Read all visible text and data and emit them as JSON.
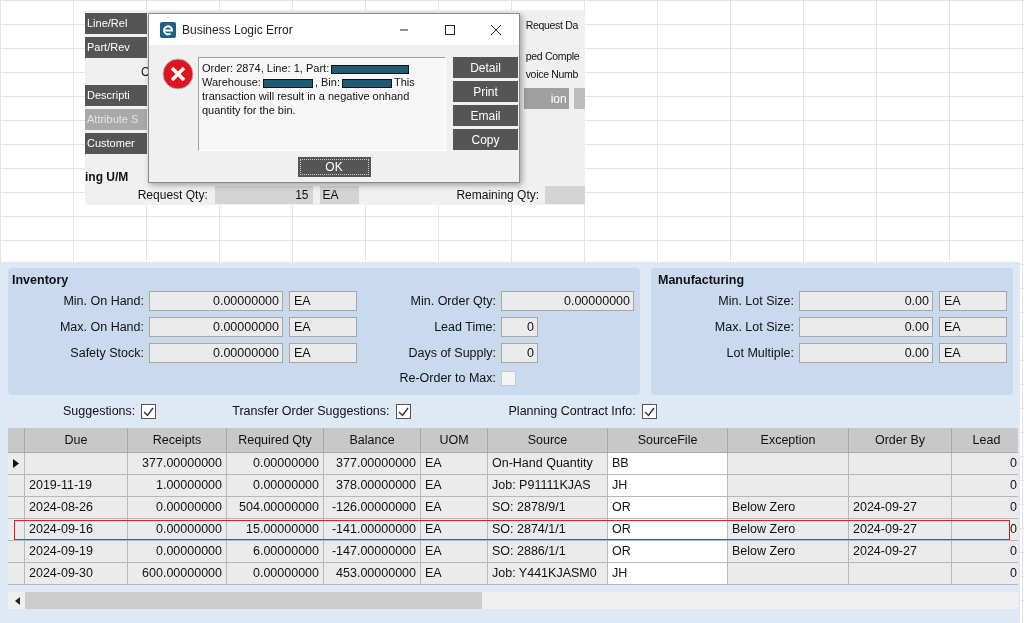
{
  "form_behind": {
    "left_items": [
      {
        "kind": "button",
        "label": "Line/Rel",
        "disabled": false
      },
      {
        "kind": "button",
        "label": "Part/Rev",
        "disabled": false
      },
      {
        "kind": "label",
        "label": "C"
      },
      {
        "kind": "button",
        "label": "Descripti",
        "disabled": false
      },
      {
        "kind": "button",
        "label": "Attribute S",
        "disabled": true
      },
      {
        "kind": "button",
        "label": "Customer",
        "disabled": false
      }
    ],
    "right_labels": [
      "Request Da",
      "ped Comple",
      "voice Numb"
    ],
    "right_button": {
      "label": "ion",
      "disabled": true
    },
    "section_title": "ing U/M",
    "request_qty": {
      "label": "Request Qty:",
      "value": "15",
      "uom": "EA"
    },
    "remaining_qty": {
      "label": "Remaining Qty:"
    }
  },
  "dialog": {
    "title": "Business Logic Error",
    "message": [
      {
        "kind": "text",
        "text": "Order: 2874, Line: 1, Part:"
      },
      {
        "kind": "redacted"
      },
      {
        "kind": "text",
        "text": "Warehouse:"
      },
      {
        "kind": "redacted"
      },
      {
        "kind": "text",
        "text": ", Bin:"
      },
      {
        "kind": "redacted"
      },
      {
        "kind": "text",
        "text": "This"
      },
      {
        "kind": "paragraph",
        "text": "transaction will result in a negative onhand quantity for the bin."
      }
    ],
    "side_buttons": [
      "Detail",
      "Print",
      "Email",
      "Copy"
    ],
    "ok_button": "OK"
  },
  "inventory": {
    "title": "Inventory",
    "fields": [
      {
        "label": "Min. On Hand:",
        "value": "0.00000000",
        "uom": "EA"
      },
      {
        "label": "Max. On Hand:",
        "value": "0.00000000",
        "uom": "EA"
      },
      {
        "label": "Safety Stock:",
        "value": "0.00000000",
        "uom": "EA"
      }
    ],
    "order_fields": [
      {
        "kind": "wide",
        "label": "Min. Order Qty:",
        "value": "0.00000000"
      },
      {
        "kind": "narrow",
        "label": "Lead Time:",
        "value": "0"
      },
      {
        "kind": "narrow",
        "label": "Days of Supply:",
        "value": "0"
      },
      {
        "kind": "checkbox",
        "label": "Re-Order to Max:",
        "checked": false,
        "disabled": true
      }
    ]
  },
  "manufacturing": {
    "title": "Manufacturing",
    "fields": [
      {
        "label": "Min. Lot Size:",
        "value": "0.00",
        "uom": "EA"
      },
      {
        "label": "Max. Lot Size:",
        "value": "0.00",
        "uom": "EA"
      },
      {
        "label": "Lot Multiple:",
        "value": "0.00",
        "uom": "EA"
      }
    ]
  },
  "options": [
    {
      "label": "Suggestions:",
      "checked": true
    },
    {
      "label": "Transfer Order Suggestions:",
      "checked": true
    },
    {
      "label": "Planning Contract Info:",
      "checked": true
    }
  ],
  "grid": {
    "columns": [
      "Due",
      "Receipts",
      "Required Qty",
      "Balance",
      "UOM",
      "Source",
      "SourceFile",
      "Exception",
      "Order By",
      "Lead"
    ],
    "rows": [
      {
        "current": true,
        "highlighted": false,
        "receipts": "377.00000000",
        "required_qty": "0.00000000",
        "balance": "377.00000000",
        "uom": "EA",
        "source": "On-Hand Quantity",
        "source_file": "BB",
        "lead": "0"
      },
      {
        "current": false,
        "highlighted": false,
        "due": "2019-11-19",
        "receipts": "1.00000000",
        "required_qty": "0.00000000",
        "balance": "378.00000000",
        "uom": "EA",
        "source": "Job: P91111KJAS",
        "source_file": "JH",
        "lead": "0"
      },
      {
        "current": false,
        "highlighted": false,
        "due": "2024-08-26",
        "receipts": "0.00000000",
        "required_qty": "504.00000000",
        "balance": "-126.00000000",
        "uom": "EA",
        "source": "SO: 2878/9/1",
        "source_file": "OR",
        "exception": "Below Zero",
        "order_by": "2024-09-27",
        "lead": "0"
      },
      {
        "current": false,
        "highlighted": true,
        "due": "2024-09-16",
        "receipts": "0.00000000",
        "required_qty": "15.00000000",
        "balance": "-141.00000000",
        "uom": "EA",
        "source": "SO: 2874/1/1",
        "source_file": "OR",
        "exception": "Below Zero",
        "order_by": "2024-09-27",
        "lead": "0"
      },
      {
        "current": false,
        "highlighted": false,
        "due": "2024-09-19",
        "receipts": "0.00000000",
        "required_qty": "6.00000000",
        "balance": "-147.00000000",
        "uom": "EA",
        "source": "SO: 2886/1/1",
        "source_file": "OR",
        "exception": "Below Zero",
        "order_by": "2024-09-27",
        "lead": "0"
      },
      {
        "current": false,
        "highlighted": false,
        "due": "2024-09-30",
        "receipts": "600.00000000",
        "required_qty": "0.00000000",
        "balance": "453.00000000",
        "uom": "EA",
        "source": "Job: Y441KJASM0",
        "source_file": "JH",
        "lead": "0"
      }
    ]
  }
}
